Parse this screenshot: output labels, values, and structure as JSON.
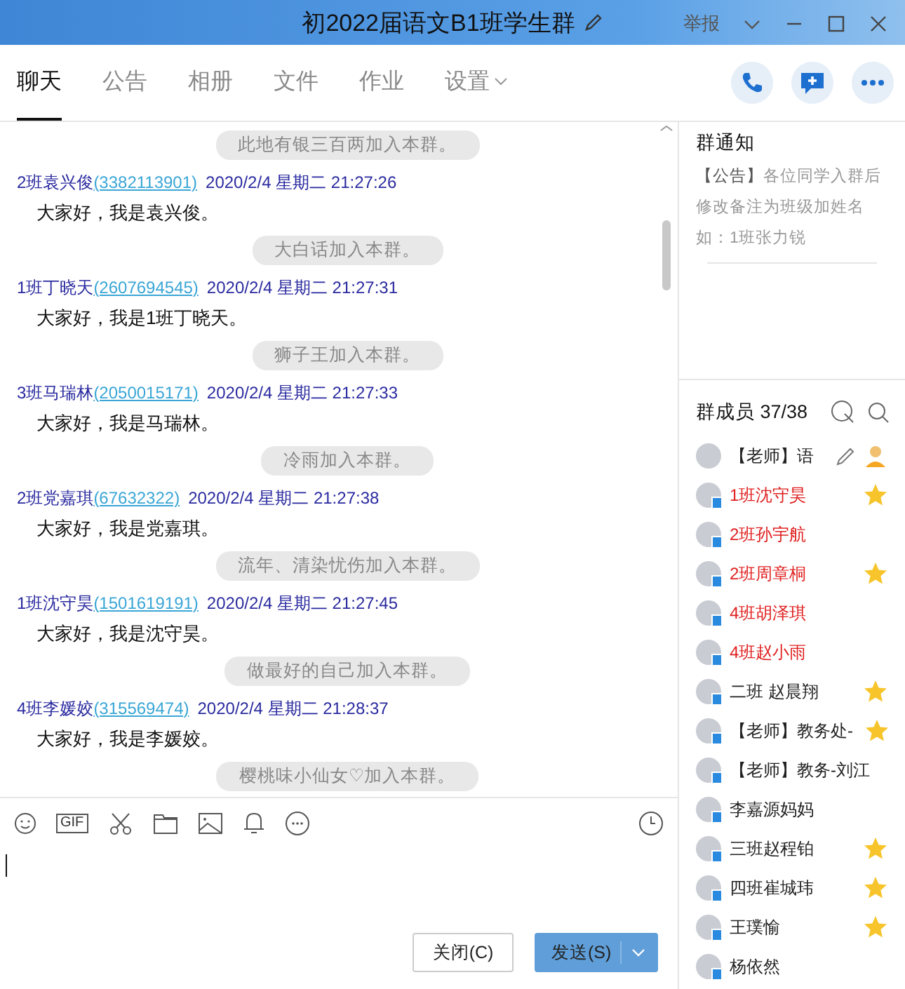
{
  "window": {
    "title": "初2022届语文B1班学生群",
    "report": "举报"
  },
  "tabs": [
    {
      "label": "聊天",
      "selected": true,
      "dropdown": false
    },
    {
      "label": "公告",
      "selected": false,
      "dropdown": false
    },
    {
      "label": "相册",
      "selected": false,
      "dropdown": false
    },
    {
      "label": "文件",
      "selected": false,
      "dropdown": false
    },
    {
      "label": "作业",
      "selected": false,
      "dropdown": false
    },
    {
      "label": "设置",
      "selected": false,
      "dropdown": true
    }
  ],
  "messages": [
    {
      "kind": "notice",
      "text": "此地有银三百两加入本群。"
    },
    {
      "kind": "message",
      "name": "2班袁兴俊",
      "qq": "(3382113901)",
      "time": "2020/2/4 星期二 21:27:26",
      "text": "大家好，我是袁兴俊。"
    },
    {
      "kind": "notice",
      "text": "大白话加入本群。"
    },
    {
      "kind": "message",
      "name": "1班丁晓天",
      "qq": "(2607694545)",
      "time": "2020/2/4 星期二 21:27:31",
      "text": "大家好，我是1班丁晓天。"
    },
    {
      "kind": "notice",
      "text": "狮子王加入本群。"
    },
    {
      "kind": "message",
      "name": "3班马瑞林",
      "qq": "(2050015171)",
      "time": "2020/2/4 星期二 21:27:33",
      "text": "大家好，我是马瑞林。"
    },
    {
      "kind": "notice",
      "text": "冷雨加入本群。"
    },
    {
      "kind": "message",
      "name": "2班党嘉琪",
      "qq": "(67632322)",
      "time": "2020/2/4 星期二 21:27:38",
      "text": "大家好，我是党嘉琪。"
    },
    {
      "kind": "notice",
      "text": "流年、清染忧伤加入本群。"
    },
    {
      "kind": "message",
      "name": "1班沈守昊",
      "qq": "(1501619191)",
      "time": "2020/2/4 星期二 21:27:45",
      "text": "大家好，我是沈守昊。"
    },
    {
      "kind": "notice",
      "text": "做最好的自己加入本群。"
    },
    {
      "kind": "message",
      "name": "4班李媛姣",
      "qq": "(315569474)",
      "time": "2020/2/4 星期二 21:28:37",
      "text": "大家好，我是李媛姣。"
    },
    {
      "kind": "notice",
      "text": "樱桃味小仙女♡加入本群。"
    }
  ],
  "toolbar": {
    "gif_label": "GIF"
  },
  "buttons": {
    "close": "关闭(C)",
    "send": "发送(S)"
  },
  "notice_panel": {
    "title": "群通知",
    "tag": "【公告】",
    "text": "各位同学入群后修改备注为班级加姓名如：1班张力锐"
  },
  "members": {
    "title": "群成员 37/38",
    "items": [
      {
        "name": "【老师】语",
        "color": "#222222",
        "star": false,
        "device": false,
        "hovered": true
      },
      {
        "name": "1班沈守昊",
        "color": "#e02020",
        "star": true,
        "device": true,
        "hovered": false
      },
      {
        "name": "2班孙宇航",
        "color": "#e02020",
        "star": false,
        "device": true,
        "hovered": false
      },
      {
        "name": "2班周章桐",
        "color": "#e02020",
        "star": true,
        "device": true,
        "hovered": false
      },
      {
        "name": "4班胡泽琪",
        "color": "#e02020",
        "star": false,
        "device": true,
        "hovered": false
      },
      {
        "name": "4班赵小雨",
        "color": "#e02020",
        "star": false,
        "device": true,
        "hovered": false
      },
      {
        "name": "二班 赵晨翔",
        "color": "#222222",
        "star": true,
        "device": true,
        "hovered": false
      },
      {
        "name": "【老师】教务处-",
        "color": "#222222",
        "star": true,
        "device": true,
        "hovered": false
      },
      {
        "name": "【老师】教务-刘江",
        "color": "#222222",
        "star": false,
        "device": true,
        "hovered": false
      },
      {
        "name": "李嘉源妈妈",
        "color": "#222222",
        "star": false,
        "device": true,
        "hovered": false
      },
      {
        "name": "三班赵程铂",
        "color": "#222222",
        "star": true,
        "device": true,
        "hovered": false
      },
      {
        "name": "四班崔城玮",
        "color": "#222222",
        "star": true,
        "device": true,
        "hovered": false
      },
      {
        "name": "王璞愉",
        "color": "#222222",
        "star": true,
        "device": true,
        "hovered": false
      },
      {
        "name": "杨依然",
        "color": "#222222",
        "star": false,
        "device": true,
        "hovered": false
      }
    ]
  }
}
